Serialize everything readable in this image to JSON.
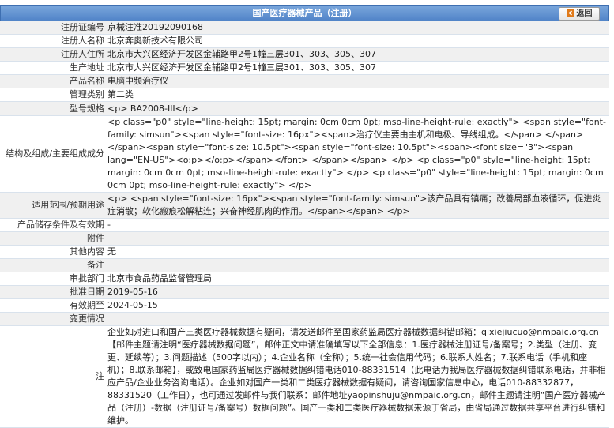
{
  "header": {
    "title": "国产医疗器械产品（注册）",
    "back_label": "返回"
  },
  "rows": [
    {
      "label": "注册证编号",
      "value": "京械注准20192090168"
    },
    {
      "label": "注册人名称",
      "value": "北京奔奥新技术有限公司"
    },
    {
      "label": "注册人住所",
      "value": "北京市大兴区经济开发区金辅路甲2号1幢三层301、303、305、307"
    },
    {
      "label": "生产地址",
      "value": "北京市大兴区经济开发区金辅路甲2号1幢三层301、303、305、307"
    },
    {
      "label": "产品名称",
      "value": "电脑中频治疗仪"
    },
    {
      "label": "管理类别",
      "value": "第二类"
    },
    {
      "label": "型号规格",
      "value": "<p> BA2008-III</p>"
    },
    {
      "label": "结构及组成/主要组成成分",
      "value": "<p class=\"p0\" style=\"line-height: 15pt; margin: 0cm 0cm 0pt; mso-line-height-rule: exactly\"> <span style=\"font-family: simsun\"><span style=\"font-size: 16px\"><span>治疗仪主要由主机和电极、导线组成。</span> </span> </span><span style=\"font-size: 10.5pt\"><span style=\"font-size: 10.5pt\"><span><font size=\"3\"><span lang=\"EN-US\"><o:p></o:p></span></font> </span></span> </p> <p class=\"p0\" style=\"line-height: 15pt; margin: 0cm 0cm 0pt; mso-line-height-rule: exactly\"> </p> <p class=\"p0\" style=\"line-height: 15pt; margin: 0cm 0cm 0pt; mso-line-height-rule: exactly\"> </p>"
    },
    {
      "label": "适用范围/预期用途",
      "value": "<p> <span style=\"font-size: 16px\"><span style=\"font-family: simsun\">该产品具有镇痛；改善局部血液循环，促进炎症消散；软化瘢痕松解粘连；兴奋神经肌肉的作用。</span></span> </p>"
    },
    {
      "label": "产品储存条件及有效期",
      "value": "-"
    },
    {
      "label": "附件",
      "value": ""
    },
    {
      "label": "其他内容",
      "value": "无"
    },
    {
      "label": "备注",
      "value": ""
    },
    {
      "label": "审批部门",
      "value": "北京市食品药品监督管理局"
    },
    {
      "label": "批准日期",
      "value": "2019-05-16"
    },
    {
      "label": "有效期至",
      "value": "2024-05-15"
    },
    {
      "label": "变更情况",
      "value": ""
    },
    {
      "label": "注",
      "value": "企业如对进口和国产三类医疗器械数据有疑问，请发送邮件至国家药监局医疗器械数据纠错邮箱：qixiejiucuo@nmpaic.org.cn【邮件主题请注明“医疗器械数据问题”，邮件正文中请准确填写以下全部信息：1.医疗器械注册证号/备案号；2.类型（注册、变更、延续等）；3.问题描述（500字以内）；4.企业名称（全称）；5.统一社会信用代码；6.联系人姓名；7.联系电话（手机和座机）；8.联系邮箱】，或致电国家药监局医疗器械数据纠错电话010-88331514（此电话为我局医疗器械数据纠错联系电话，并非相应产品/企业业务咨询电话）。企业如对国产一类和二类医疗器械数据有疑问，请咨询国家信息中心，电话010-88332877，88331520（工作日），也可通过发邮件与我们联系：邮件地址yaopinshuju@nmpaic.org.cn，邮件主题请注明“国产医疗器械产品（注册）-数据（注册证号/备案号）数据问题”。国产一类和二类医疗器械数据来源于省局，由省局通过数据共享平台进行纠错和维护。"
    }
  ]
}
